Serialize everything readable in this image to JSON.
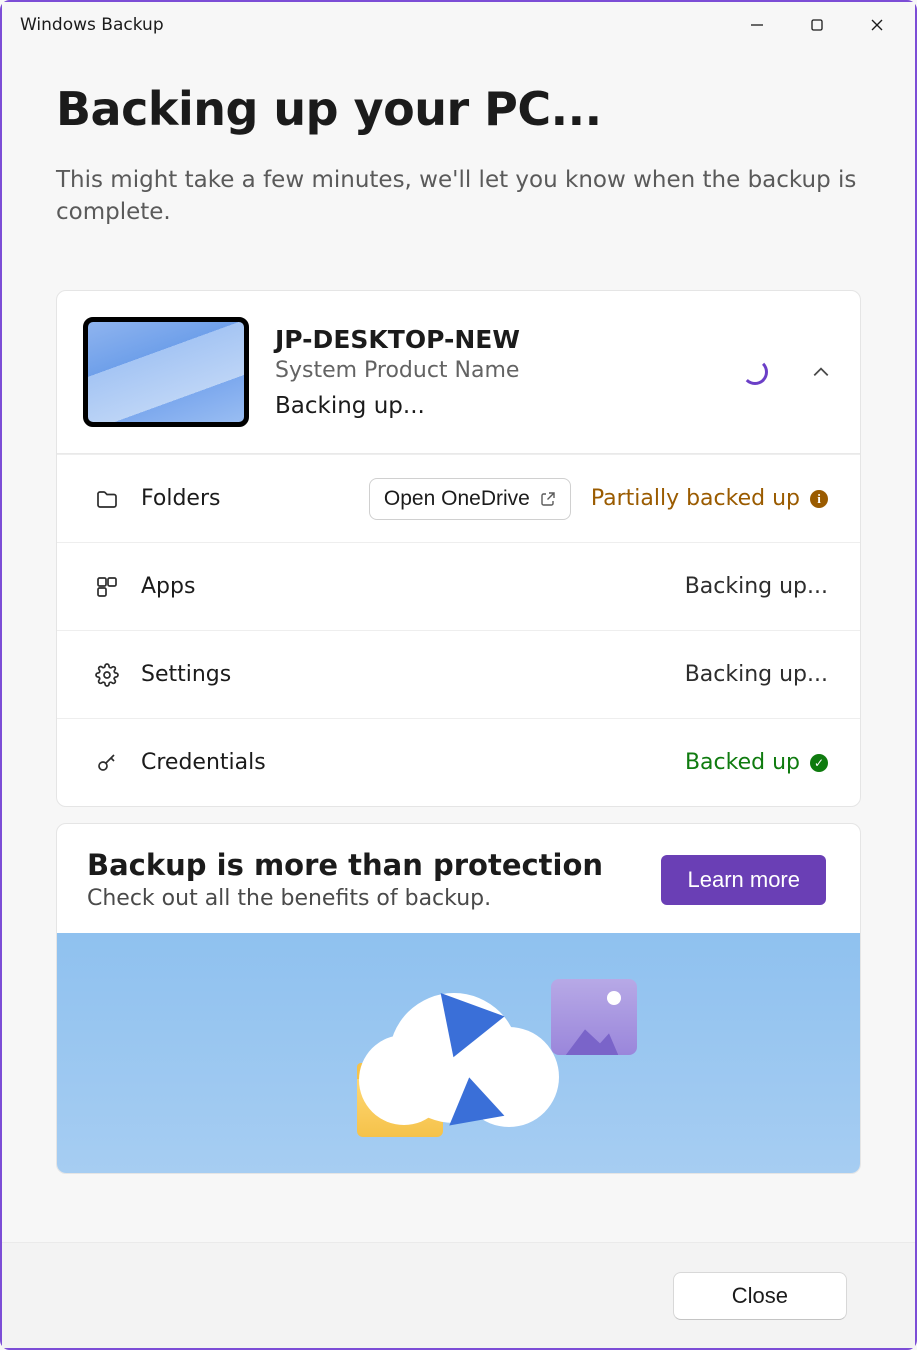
{
  "window": {
    "title": "Windows Backup"
  },
  "page": {
    "title": "Backing up your PC...",
    "subtitle": "This might take a few minutes, we'll let you know when the backup is complete."
  },
  "device": {
    "name": "JP-DESKTOP-NEW",
    "product": "System Product Name",
    "status": "Backing up..."
  },
  "categories": {
    "folders": {
      "label": "Folders",
      "open_label": "Open OneDrive",
      "status": "Partially backed up"
    },
    "apps": {
      "label": "Apps",
      "status": "Backing up..."
    },
    "settings": {
      "label": "Settings",
      "status": "Backing up..."
    },
    "credentials": {
      "label": "Credentials",
      "status": "Backed up"
    }
  },
  "promo": {
    "title": "Backup is more than protection",
    "subtitle": "Check out all the benefits of backup.",
    "cta": "Learn more"
  },
  "footer": {
    "close": "Close"
  }
}
